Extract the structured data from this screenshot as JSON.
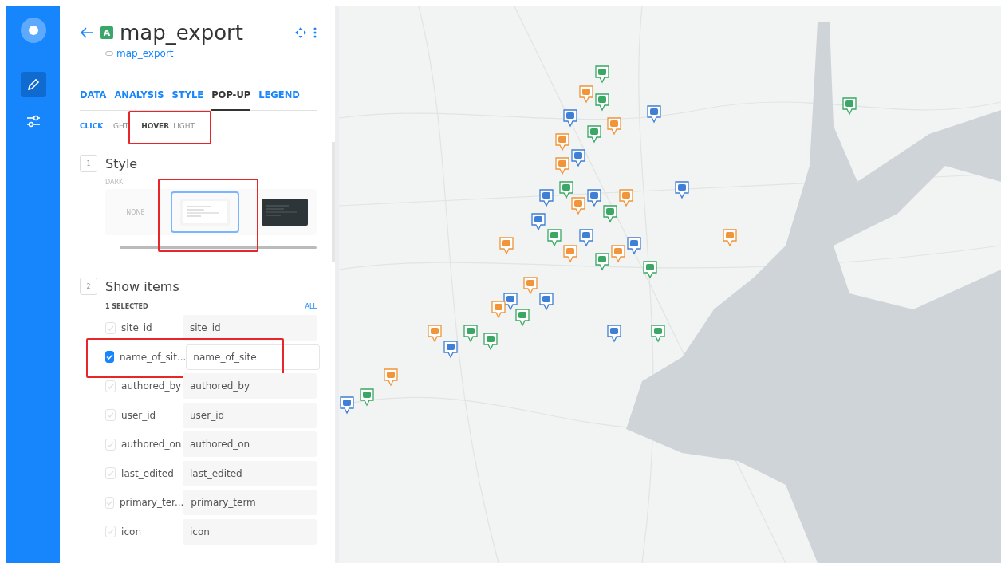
{
  "sidebar": {
    "items": [
      {
        "kind": "edit",
        "selected": true
      },
      {
        "kind": "settings",
        "selected": false
      }
    ]
  },
  "layer": {
    "badge": "A",
    "title": "map_export",
    "source": "map_export"
  },
  "tabs": [
    {
      "label": "DATA",
      "selected": false
    },
    {
      "label": "ANALYSIS",
      "selected": false
    },
    {
      "label": "STYLE",
      "selected": false
    },
    {
      "label": "POP-UP",
      "selected": true
    },
    {
      "label": "LEGEND",
      "selected": false
    }
  ],
  "subtabs": [
    {
      "label": "CLICK",
      "note": "LIGHT",
      "selected": false
    },
    {
      "label": "HOVER",
      "note": "LIGHT",
      "selected": true,
      "annotated": true
    }
  ],
  "style_section": {
    "number": "1",
    "title": "Style",
    "caption": "DARK",
    "options": [
      {
        "kind": "none",
        "label": "NONE",
        "selected": false
      },
      {
        "kind": "light",
        "selected": true,
        "annotated": true
      },
      {
        "kind": "dark",
        "selected": false
      }
    ]
  },
  "items_section": {
    "number": "2",
    "title": "Show items",
    "count": "1 SELECTED",
    "all_link": "ALL",
    "items": [
      {
        "name": "site_id",
        "value": "site_id",
        "checked": false
      },
      {
        "name": "name_of_sit...",
        "value": "name_of_site",
        "checked": true,
        "annotated": true
      },
      {
        "name": "authored_by",
        "value": "authored_by",
        "checked": false
      },
      {
        "name": "user_id",
        "value": "user_id",
        "checked": false
      },
      {
        "name": "authored_on",
        "value": "authored_on",
        "checked": false
      },
      {
        "name": "last_edited",
        "value": "last_edited",
        "checked": false
      },
      {
        "name": "primary_ter...",
        "value": "primary_term",
        "checked": false
      },
      {
        "name": "icon",
        "value": "icon",
        "checked": false
      }
    ]
  }
}
